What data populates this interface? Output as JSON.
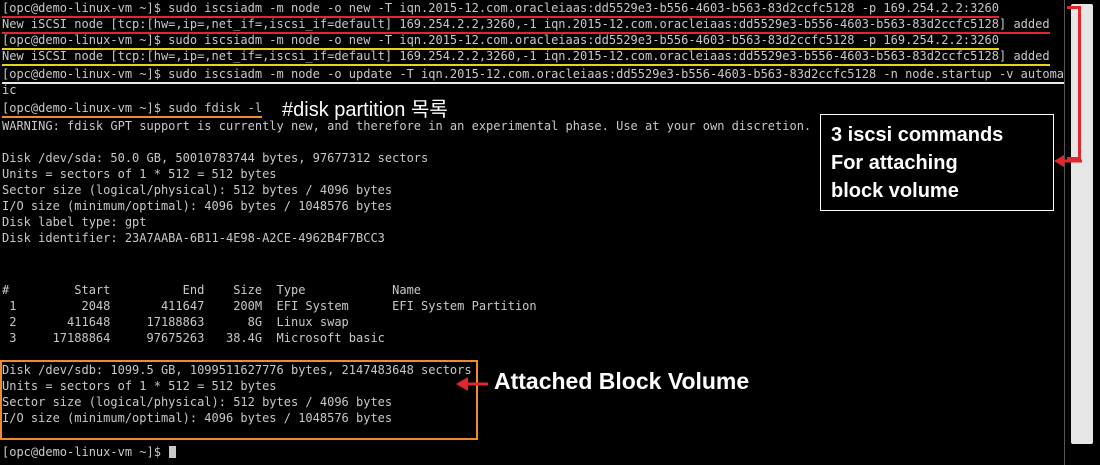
{
  "terminal": {
    "lines": [
      "[opc@demo-linux-vm ~]$ sudo iscsiadm -m node -o new -T iqn.2015-12.com.oracleiaas:dd5529e3-b556-4603-b563-83d2ccfc5128 -p 169.254.2.2:3260",
      "New iSCSI node [tcp:[hw=,ip=,net_if=,iscsi_if=default] 169.254.2.2,3260,-1 iqn.2015-12.com.oracleiaas:dd5529e3-b556-4603-b563-83d2ccfc5128] added",
      "[opc@demo-linux-vm ~]$ sudo iscsiadm -m node -o new -T iqn.2015-12.com.oracleiaas:dd5529e3-b556-4603-b563-83d2ccfc5128 -p 169.254.2.2:3260",
      "New iSCSI node [tcp:[hw=,ip=,net_if=,iscsi_if=default] 169.254.2.2,3260,-1 iqn.2015-12.com.oracleiaas:dd5529e3-b556-4603-b563-83d2ccfc5128] added",
      "[opc@demo-linux-vm ~]$ sudo iscsiadm -m node -o update -T iqn.2015-12.com.oracleiaas:dd5529e3-b556-4603-b563-83d2ccfc5128 -n node.startup -v automat",
      "ic",
      "[opc@demo-linux-vm ~]$ sudo fdisk -l",
      "WARNING: fdisk GPT support is currently new, and therefore in an experimental phase. Use at your own discretion.",
      "",
      "Disk /dev/sda: 50.0 GB, 50010783744 bytes, 97677312 sectors",
      "Units = sectors of 1 * 512 = 512 bytes",
      "Sector size (logical/physical): 512 bytes / 4096 bytes",
      "I/O size (minimum/optimal): 4096 bytes / 1048576 bytes",
      "Disk label type: gpt",
      "Disk identifier: 23A7AABA-6B11-4E98-A2CE-4962B4F7BCC3",
      "",
      "",
      "#         Start          End    Size  Type            Name",
      " 1         2048       411647    200M  EFI System      EFI System Partition",
      " 2       411648     17188863      8G  Linux swap",
      " 3     17188864     97675263   38.4G  Microsoft basic",
      "",
      "Disk /dev/sdb: 1099.5 GB, 1099511627776 bytes, 2147483648 sectors",
      "Units = sectors of 1 * 512 = 512 bytes",
      "Sector size (logical/physical): 512 bytes / 4096 bytes",
      "I/O size (minimum/optimal): 4096 bytes / 1048576 bytes",
      "",
      "[opc@demo-linux-vm ~]$ "
    ]
  },
  "annotations": {
    "partition_note": "#disk partition 목록",
    "iscsi_callout": "3 iscsi commands\nFor attaching\nblock volume",
    "block_volume_label": "Attached Block Volume"
  },
  "colors": {
    "background": "#000000",
    "text": "#c8c8c8",
    "red": "#e3262b",
    "yellow": "#e8d21a",
    "orange": "#f08a2c",
    "white": "#ffffff"
  }
}
